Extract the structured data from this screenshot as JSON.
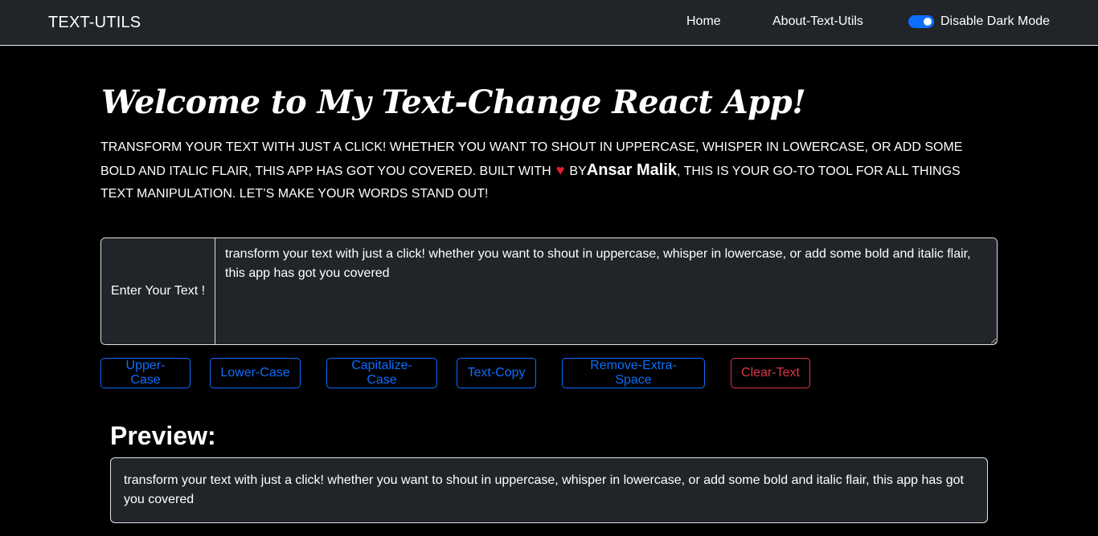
{
  "navbar": {
    "brand": "TEXT-UTILS",
    "links": [
      "Home",
      "About-Text-Utils"
    ],
    "toggle_label": "Disable Dark Mode",
    "toggle_on": true
  },
  "hero": {
    "title": "Welcome to My Text-Change React App!",
    "desc_part1": "Transform your text with just a click! Whether you want to shout in uppercase, whisper in lowercase, or add some bold and italic flair, this app has got you covered. Built with",
    "heart": "♥",
    "desc_by": "by",
    "author": "Ansar Malik",
    "desc_part2": ", this is your go-to tool for all things text manipulation. Let’s make your words stand out!"
  },
  "input": {
    "label": "Enter Your Text !",
    "value": "transform your text with just a click! whether you want to shout in uppercase, whisper in lowercase, or add some bold and italic flair, this app has got you covered"
  },
  "buttons": [
    "Upper-Case",
    "Lower-Case",
    "Capitalize-Case",
    "Text-Copy",
    "Remove-Extra-Space",
    "Clear-Text"
  ],
  "preview": {
    "title": "Preview:",
    "text": "transform your text with just a click! whether you want to shout in uppercase, whisper in lowercase, or add some bold and italic flair, this app has got you covered"
  },
  "colors": {
    "navbar_bg": "#212529",
    "page_bg": "#000000",
    "primary": "#0d6efd",
    "danger": "#dc3545",
    "heart": "#e81c2c"
  }
}
